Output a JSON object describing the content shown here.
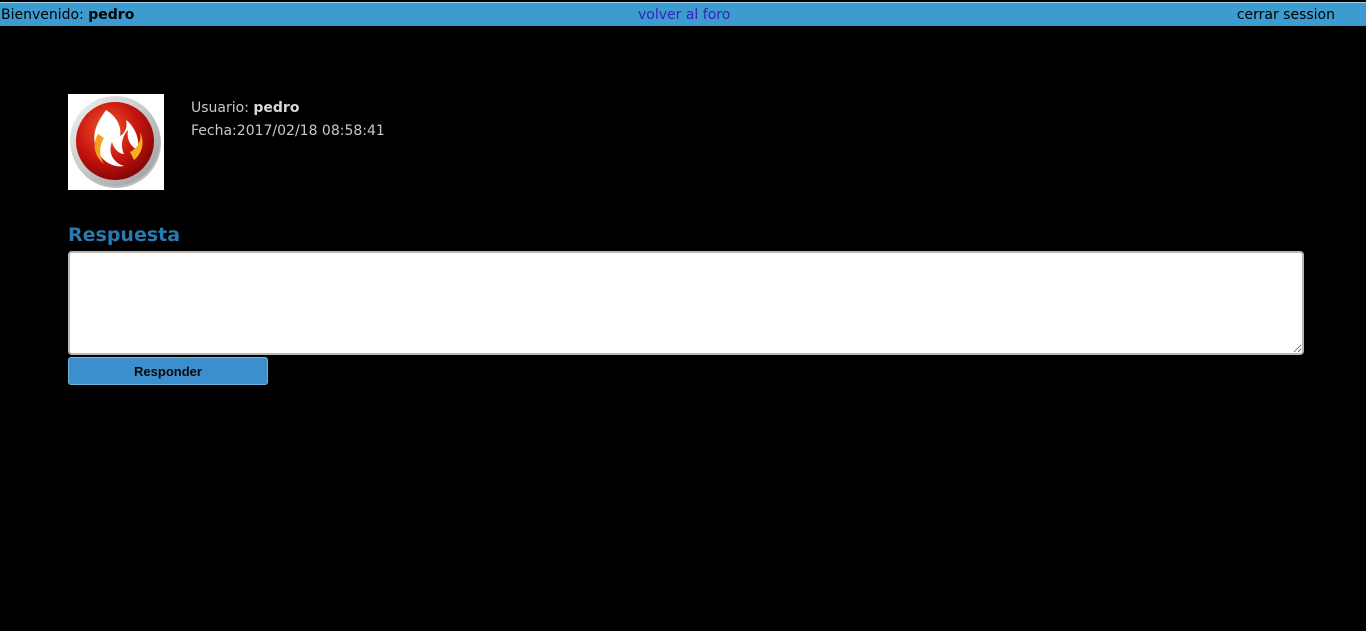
{
  "header": {
    "welcome_label": "Bienvenido:",
    "username": "pedro",
    "back_link": "volver al foro",
    "logout_link": "cerrar session"
  },
  "post": {
    "avatar_icon": "fire-logo-icon",
    "user_label": "Usuario:",
    "username": "pedro",
    "date_label": "Fecha:",
    "date_value": "2017/02/18 08:58:41"
  },
  "reply": {
    "title": "Respuesta",
    "textarea_value": "",
    "button_label": "Responder"
  },
  "colors": {
    "topbar": "#3d9ccf",
    "link": "#3a1fb4",
    "title": "#2a7ab0",
    "button": "#3a8fcc",
    "background": "#000000"
  }
}
